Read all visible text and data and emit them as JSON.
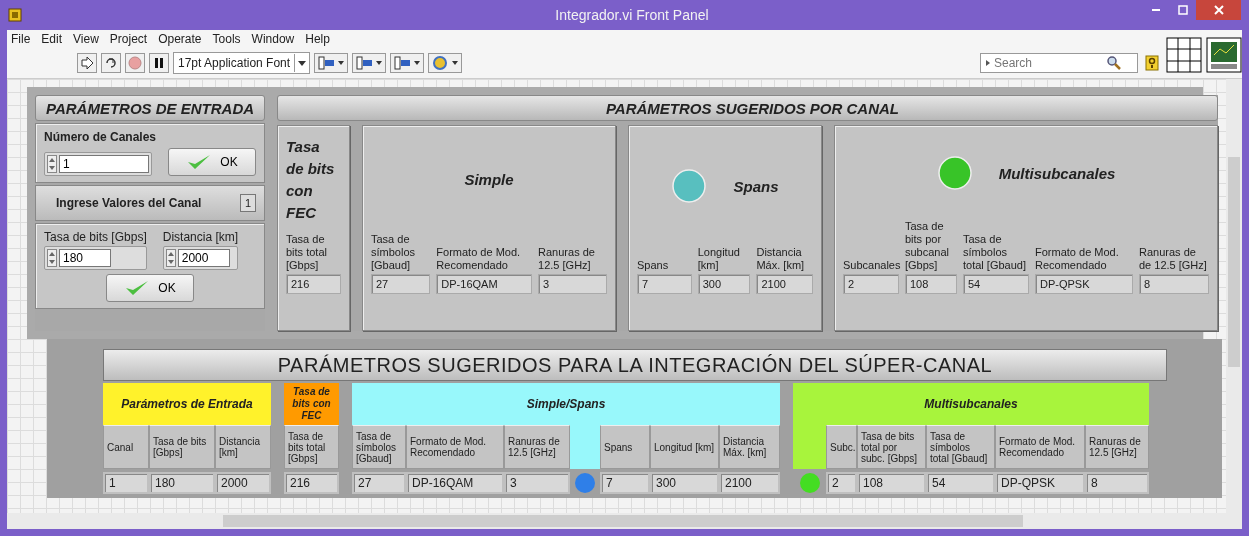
{
  "window": {
    "title": "Integrador.vi Front Panel"
  },
  "menu": [
    "File",
    "Edit",
    "View",
    "Project",
    "Operate",
    "Tools",
    "Window",
    "Help"
  ],
  "toolbar": {
    "font": "17pt Application Font",
    "search": {
      "placeholder": "Search"
    }
  },
  "input_panel": {
    "title": "PARÁMETROS DE ENTRADA",
    "channels": {
      "label": "Número de Canales",
      "value": "1"
    },
    "ok_1": "OK",
    "channel_header": "Ingrese Valores del Canal",
    "channel_index": "1",
    "fields": [
      {
        "label": "Tasa de bits [Gbps]",
        "value": "180"
      },
      {
        "label": "Distancia [km]",
        "value": "2000"
      }
    ],
    "ok_2": "OK"
  },
  "per_channel": {
    "title": "PARÁMETROS SUGERIDOS POR CANAL",
    "groups": [
      {
        "title": "Tasa de bits con FEC",
        "columns": [
          {
            "label": "Tasa de bits total [Gbps]",
            "value": "216"
          }
        ]
      },
      {
        "title": "Simple",
        "columns": [
          {
            "label": "Tasa de símbolos [Gbaud]",
            "value": "27"
          },
          {
            "label": "Formato de Mod. Recomendado",
            "value": "DP-16QAM"
          },
          {
            "label": "Ranuras de 12.5 [GHz]",
            "value": "3"
          }
        ]
      },
      {
        "title": "Spans",
        "led": {
          "on": false
        },
        "columns": [
          {
            "label": "Spans",
            "value": "7"
          },
          {
            "label": "Longitud [km]",
            "value": "300"
          },
          {
            "label": "Distancia Máx. [km]",
            "value": "2100"
          }
        ]
      },
      {
        "title": "Multisubcanales",
        "led": {
          "on": true
        },
        "columns": [
          {
            "label": "Subcanales",
            "value": "2"
          },
          {
            "label": "Tasa de bits por subcanal [Gbps]",
            "value": "108"
          },
          {
            "label": "Tasa de símbolos total [Gbaud]",
            "value": "54"
          },
          {
            "label": "Formato de Mod. Recomendado",
            "value": "DP-QPSK"
          },
          {
            "label": "Ranuras de de 12.5 [GHz]",
            "value": "8"
          }
        ]
      }
    ]
  },
  "super_channel": {
    "title": "PARÁMETROS SUGERIDOS PARA LA INTEGRACIÓN DEL SÚPER-CANAL",
    "groups": [
      {
        "title": "Parámetros de Entrada",
        "color": "#fff22b",
        "cells": [
          {
            "kind": "column",
            "label": "Canal",
            "value": "1"
          },
          {
            "kind": "column",
            "label": "Tasa de bits [Gbps]",
            "value": "180"
          },
          {
            "kind": "column",
            "label": "Distancia [km]",
            "value": "2000"
          }
        ]
      },
      {
        "title": "Tasa de bits con FEC",
        "color": "#ff9a00",
        "cells": [
          {
            "kind": "column",
            "label": "Tasa de bits total [Gbps]",
            "value": "216"
          }
        ]
      },
      {
        "title": "Simple/Spans",
        "color": "#98f8fb",
        "cells": [
          {
            "kind": "column",
            "label": "Tasa de símbolos [Gbaud]",
            "value": "27"
          },
          {
            "kind": "column",
            "label": "Formato de Mod. Recomendado",
            "value": "DP-16QAM"
          },
          {
            "kind": "column",
            "label": "Ranuras de 12.5 [GHz]",
            "value": "3"
          },
          {
            "kind": "led",
            "color": "#2f7fe8"
          },
          {
            "kind": "column",
            "label": "Spans",
            "value": "7"
          },
          {
            "kind": "column",
            "label": "Longitud [km]",
            "value": "300"
          },
          {
            "kind": "column",
            "label": "Distancia Máx. [km]",
            "value": "2100"
          }
        ]
      },
      {
        "title": "Multisubcanales",
        "color": "#a8f43c",
        "cells": [
          {
            "kind": "led",
            "color": "#44dd22"
          },
          {
            "kind": "column",
            "label": "Subc.",
            "value": "2"
          },
          {
            "kind": "column",
            "label": "Tasa de bits total por subc. [Gbps]",
            "value": "108"
          },
          {
            "kind": "column",
            "label": "Tasa de símbolos total [Gbaud]",
            "value": "54"
          },
          {
            "kind": "column",
            "label": "Formato de Mod. Recomendado",
            "value": "DP-QPSK"
          },
          {
            "kind": "column",
            "label": "Ranuras de 12.5 [GHz]",
            "value": "8"
          }
        ]
      }
    ]
  }
}
